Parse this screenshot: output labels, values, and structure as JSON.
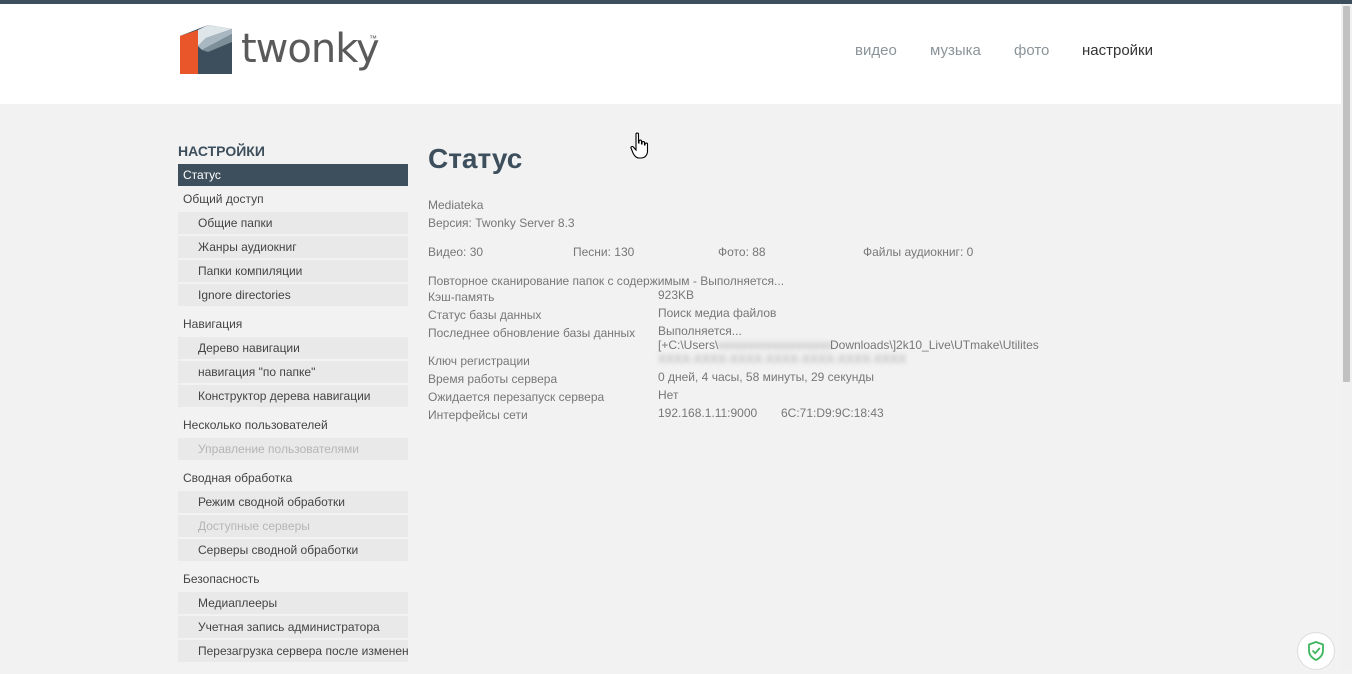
{
  "header": {
    "logo_text": "twonky",
    "logo_tm": "™",
    "nav": [
      {
        "label": "видео",
        "active": false
      },
      {
        "label": "музыка",
        "active": false
      },
      {
        "label": "фото",
        "active": false
      },
      {
        "label": "настройки",
        "active": true
      }
    ]
  },
  "sidebar": {
    "title": "НАСТРОЙКИ",
    "items": [
      {
        "label": "Статус"
      },
      {
        "label": "Общий доступ"
      },
      {
        "label": "Общие папки"
      },
      {
        "label": "Жанры аудиокниг"
      },
      {
        "label": "Папки компиляции"
      },
      {
        "label": "Ignore directories"
      },
      {
        "label": "Навигация"
      },
      {
        "label": "Дерево навигации"
      },
      {
        "label": "навигация \"по папке\""
      },
      {
        "label": "Конструктор дерева навигации"
      },
      {
        "label": "Несколько пользователей"
      },
      {
        "label": "Управление пользователями"
      },
      {
        "label": "Сводная обработка"
      },
      {
        "label": "Режим сводной обработки"
      },
      {
        "label": "Доступные серверы"
      },
      {
        "label": "Серверы сводной обработки"
      },
      {
        "label": "Безопасность"
      },
      {
        "label": "Медиаплееры"
      },
      {
        "label": "Учетная запись администратора"
      },
      {
        "label": "Перезагрузка сервера после изменения"
      }
    ]
  },
  "main": {
    "title": "Статус",
    "server_name": "Mediateka",
    "version": "Версия: Twonky Server 8.3",
    "counts": {
      "video": "Видео: 30",
      "songs": "Песни: 130",
      "photos": "Фото: 88",
      "audiobooks": "Файлы аудиокниг: 0"
    },
    "rescan": "Повторное сканирование папок с содержимым - Выполняется...",
    "rows": {
      "cache_label": "Кэш-память",
      "cache_value": "923KB",
      "db_status_label": "Статус базы данных",
      "db_status_value": "Поиск медиа файлов",
      "db_update_label": "Последнее обновление базы данных",
      "db_update_value1": "Выполняется...",
      "db_update_value2a": "[+C:\\Users\\",
      "db_update_value2b": "Downloads\\]2k10_Live\\UTmake\\Utilites",
      "reg_key_label": "Ключ регистрации",
      "uptime_label": "Время работы сервера",
      "uptime_value": "0 дней, 4 часы, 58 минуты, 29 секунды",
      "restart_label": "Ожидается перезапуск сервера",
      "restart_value": "Нет",
      "network_label": "Интерфейсы сети",
      "network_ip": "192.168.1.11:9000",
      "network_mac": "6C:71:D9:9C:18:43"
    }
  },
  "colors": {
    "brand_dark": "#3d4f5c",
    "logo_orange": "#e8562a",
    "shield_green": "#3fb55e"
  }
}
